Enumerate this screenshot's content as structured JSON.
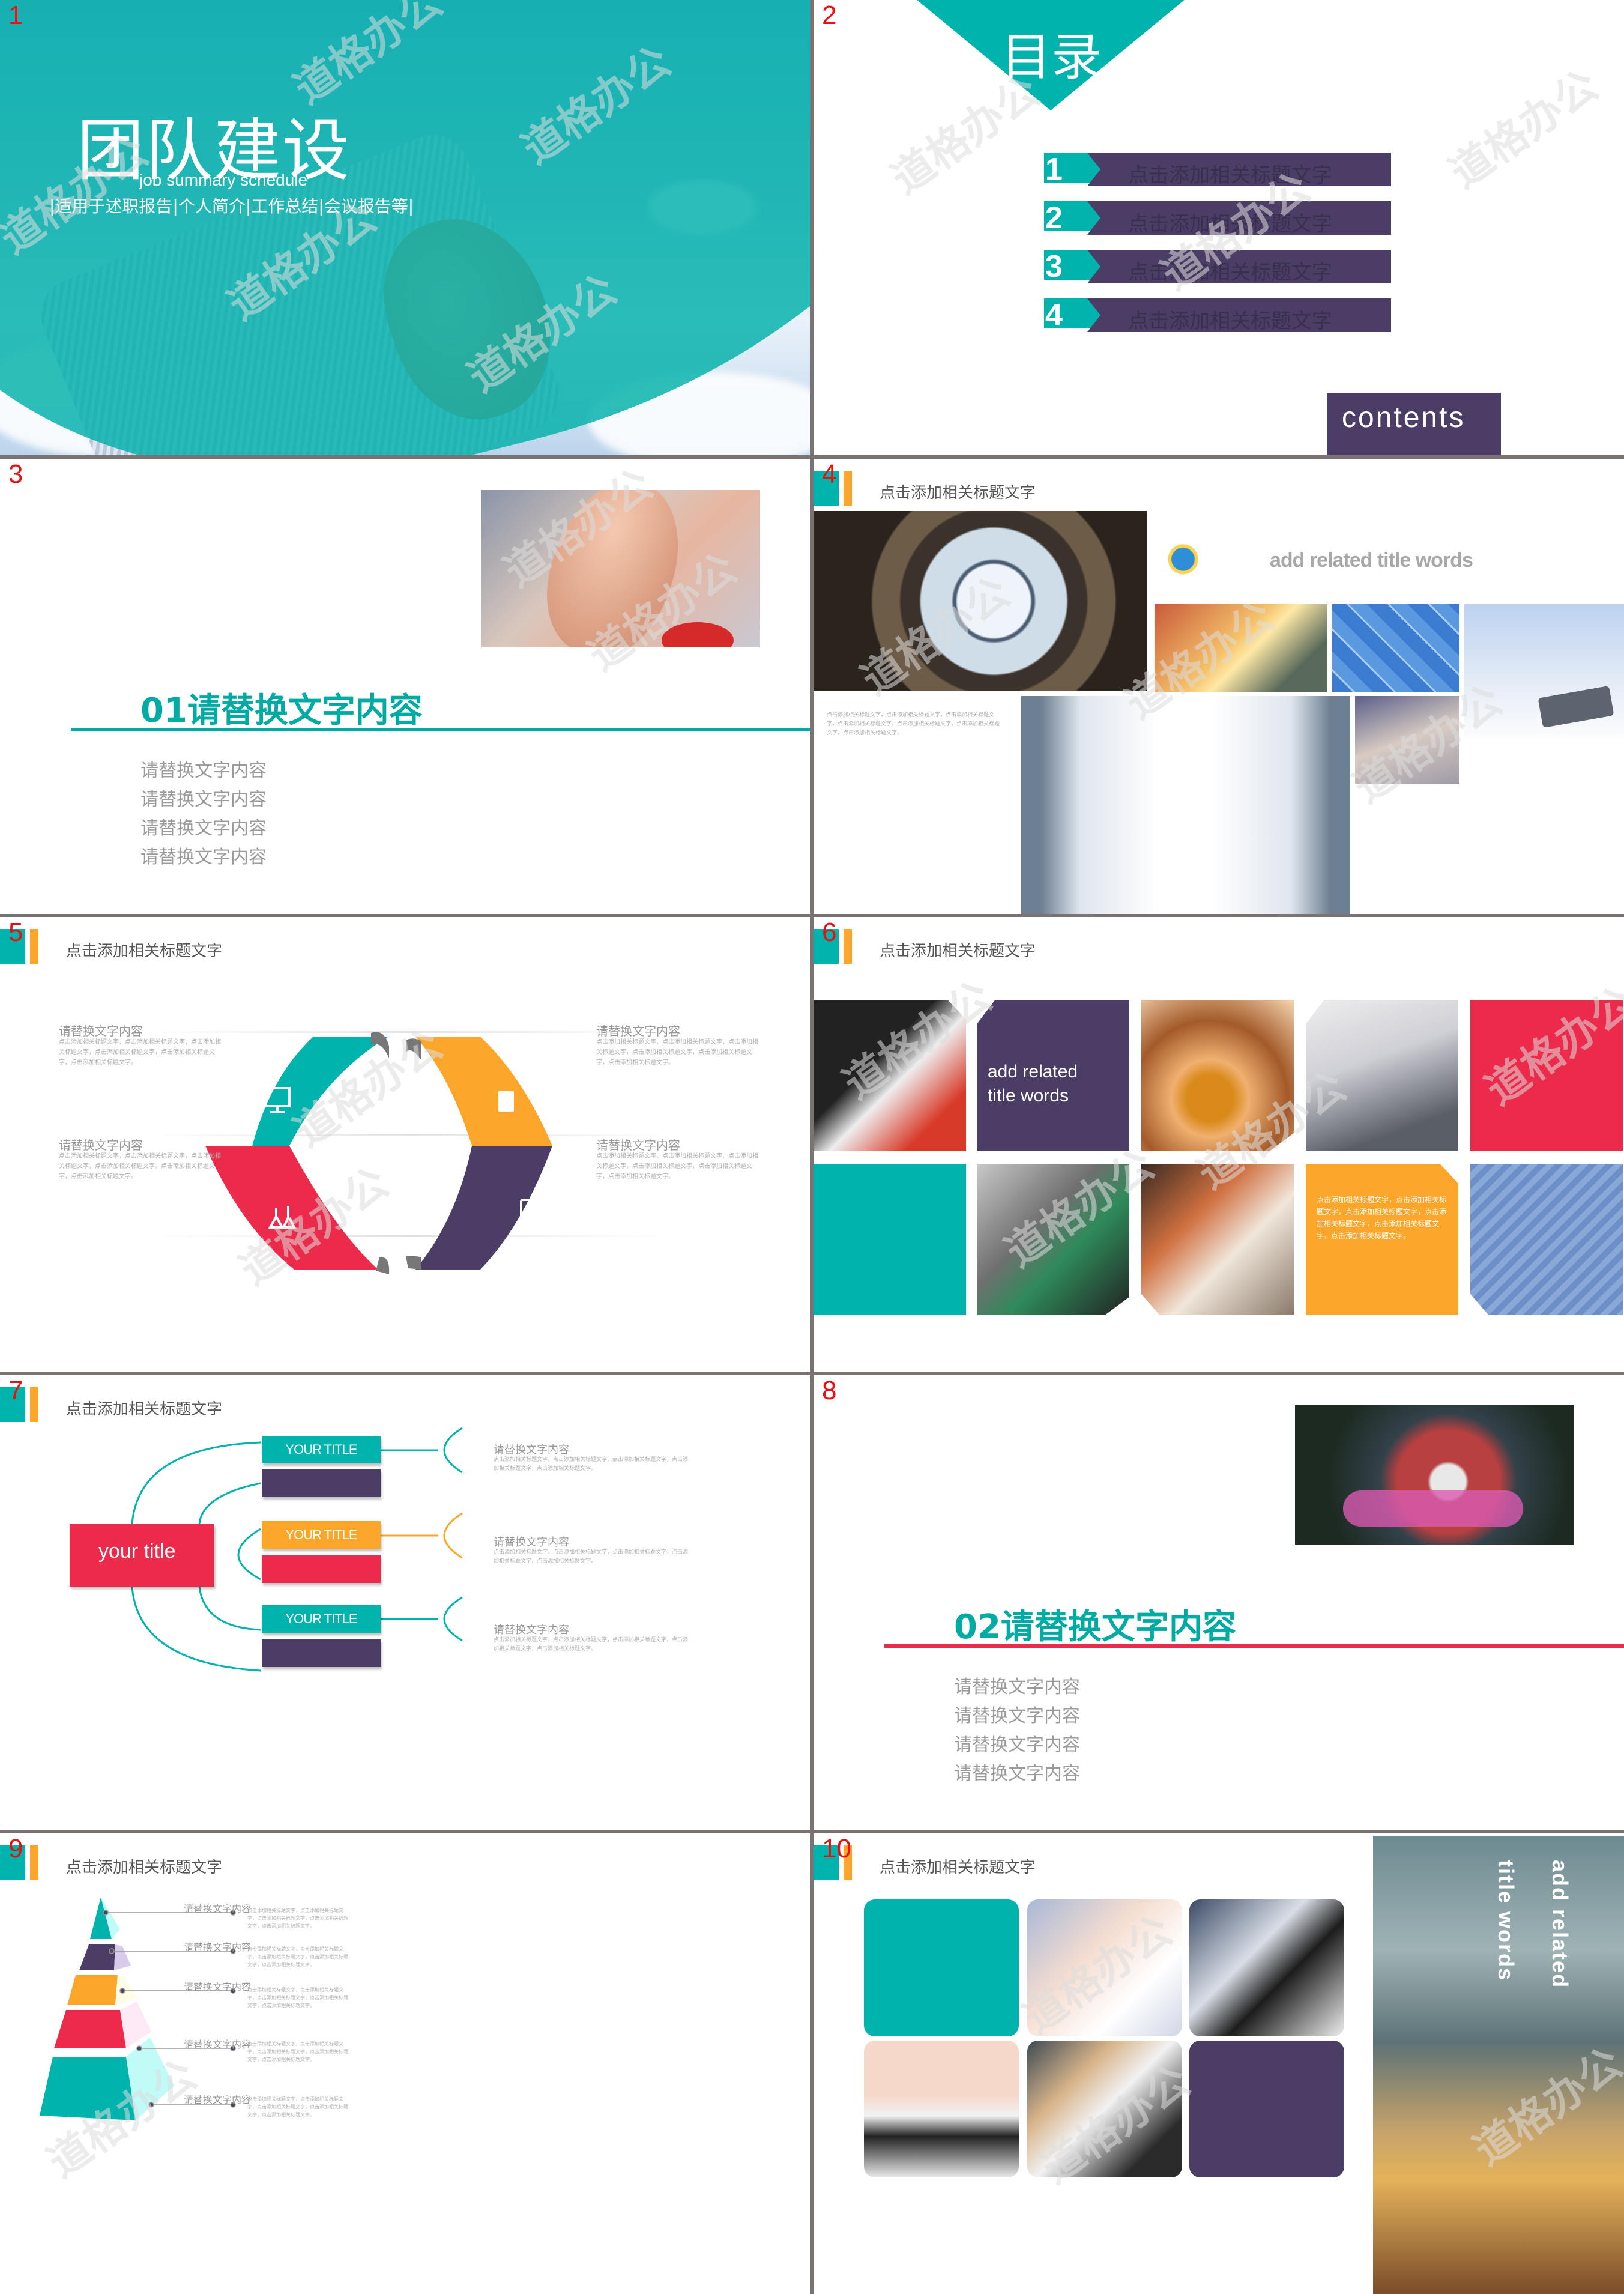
{
  "watermark": "道格办公",
  "colors": {
    "teal": "#00b3ac",
    "purple": "#4c3d66",
    "red": "#ec2a4b",
    "orange": "#fba62b",
    "slide_number": "#e81010",
    "divider": "#7a7372"
  },
  "slides": [
    {
      "number": "1",
      "title": "团队建设",
      "subtitle": "job summary schedule",
      "tagline": "|适用于述职报告|个人简介|工作总结|会议报告等|"
    },
    {
      "number": "2",
      "title": "目录",
      "items": [
        {
          "num": "1",
          "label": "点击添加相关标题文字"
        },
        {
          "num": "2",
          "label": "点击添加相关标题文字"
        },
        {
          "num": "3",
          "label": "点击添加相关标题文字"
        },
        {
          "num": "4",
          "label": "点击添加相关标题文字"
        }
      ],
      "contents_label": "contents"
    },
    {
      "number": "3",
      "section_title": "01请替换文字内容",
      "items": [
        "请替换文字内容",
        "请替换文字内容",
        "请替换文字内容",
        "请替换文字内容"
      ]
    },
    {
      "number": "4",
      "header": "点击添加相关标题文字",
      "add_title": "add related  title words",
      "paragraph": "点击添加相关标题文字，点击添加相关标题文字，点击添加相关标题文字，点击添加相关标题文字，点击添加相关标题文字，点击添加相关标题文字，点击添加相关标题文字。"
    },
    {
      "number": "5",
      "header": "点击添加相关标题文字",
      "items": [
        {
          "title": "请替换文字内容",
          "text": "点击添加相关标题文字，点击添加相关标题文字，点击添加相关标题文字，点击添加相关标题文字，点击添加相关标题文字，点击添加相关标题文字。",
          "icon": "monitor-cube-icon"
        },
        {
          "title": "请替换文字内容",
          "text": "点击添加相关标题文字，点击添加相关标题文字，点击添加相关标题文字，点击添加相关标题文字，点击添加相关标题文字，点击添加相关标题文字。",
          "icon": "id-card-icon"
        },
        {
          "title": "请替换文字内容",
          "text": "点击添加相关标题文字，点击添加相关标题文字，点击添加相关标题文字，点击添加相关标题文字，点击添加相关标题文字，点击添加相关标题文字。",
          "icon": "lab-flask-icon"
        },
        {
          "title": "请替换文字内容",
          "text": "点击添加相关标题文字，点击添加相关标题文字，点击添加相关标题文字，点击添加相关标题文字，点击添加相关标题文字，点击添加相关标题文字。",
          "icon": "iv-drip-icon"
        }
      ]
    },
    {
      "number": "6",
      "header": "点击添加相关标题文字",
      "add_title_line1": "add related",
      "add_title_line2": "title words",
      "orange_text": "点击添加相关标题文字，点击添加相关标题文字，点击添加相关标题文字，点击添加相关标题文字，点击添加相关标题文字，点击添加相关标题文字。"
    },
    {
      "number": "7",
      "header": "点击添加相关标题文字",
      "center_label": "your title",
      "boxes": [
        "YOUR TITLE",
        "",
        "YOUR TITLE",
        "",
        "YOUR TITLE",
        ""
      ],
      "items": [
        {
          "title": "请替换文字内容",
          "text": "点击添加相关标题文字，点击添加相关标题文字，点击添加相关标题文字，点击添加相关标题文字，点击添加相关标题文字。"
        },
        {
          "title": "请替换文字内容",
          "text": "点击添加相关标题文字，点击添加相关标题文字，点击添加相关标题文字，点击添加相关标题文字，点击添加相关标题文字。"
        },
        {
          "title": "请替换文字内容",
          "text": "点击添加相关标题文字，点击添加相关标题文字，点击添加相关标题文字，点击添加相关标题文字，点击添加相关标题文字。"
        }
      ]
    },
    {
      "number": "8",
      "section_title": "02请替换文字内容",
      "items": [
        "请替换文字内容",
        "请替换文字内容",
        "请替换文字内容",
        "请替换文字内容"
      ]
    },
    {
      "number": "9",
      "header": "点击添加相关标题文字",
      "levels": [
        {
          "label": "请替换文字内容",
          "text": "点击添加相关标题文字，点击添加相关标题文字，点击添加相关标题文字，点击添加相关标题文字，点击添加相关标题文字。"
        },
        {
          "label": "请替换文字内容",
          "text": "点击添加相关标题文字，点击添加相关标题文字，点击添加相关标题文字，点击添加相关标题文字，点击添加相关标题文字。"
        },
        {
          "label": "请替换文字内容",
          "text": "点击添加相关标题文字，点击添加相关标题文字，点击添加相关标题文字，点击添加相关标题文字，点击添加相关标题文字。"
        },
        {
          "label": "请替换文字内容",
          "text": "点击添加相关标题文字，点击添加相关标题文字，点击添加相关标题文字，点击添加相关标题文字，点击添加相关标题文字。"
        },
        {
          "label": "请替换文字内容",
          "text": "点击添加相关标题文字，点击添加相关标题文字，点击添加相关标题文字，点击添加相关标题文字，点击添加相关标题文字。"
        }
      ]
    },
    {
      "number": "10",
      "header": "点击添加相关标题文字",
      "vertical_title_1": "add related",
      "vertical_title_2": "title words"
    }
  ]
}
